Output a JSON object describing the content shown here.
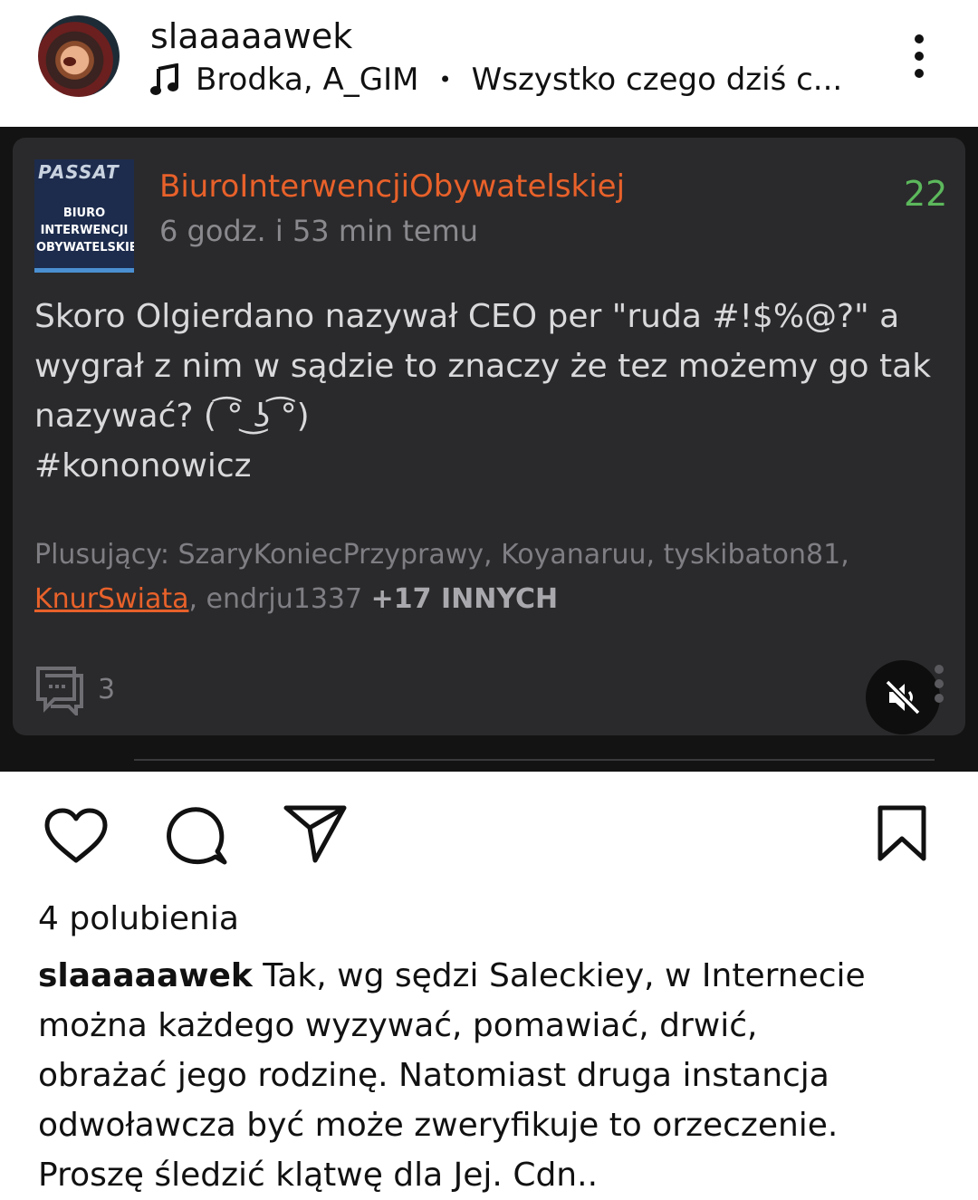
{
  "header": {
    "username": "slaaaaawek",
    "music_artist": "Brodka, A_GIM",
    "separator": "•",
    "music_title": "Wszystko czego dziś c..."
  },
  "post_card": {
    "logo_top": "PASSAT",
    "logo_lines": [
      "BIURO",
      "INTERWENCJI",
      "OBYWATELSKIE"
    ],
    "author": "BiuroInterwencjiObywatelskiej",
    "time_ago": "6 godz. i 53 min temu",
    "score": "22",
    "text_lines": [
      "Skoro Olgierdano nazywał CEO per \"ruda #!$%@?\" a",
      "wygrał z nim w sądzie to znaczy że tez możemy go tak",
      "nazywać? ( ͡° ͜ʖ ͡°)",
      "#kononowicz"
    ],
    "plus_prefix": "Plusujący: SzaryKoniecPrzyprawy, Koyanaruu, tyskibaton81,",
    "plus_user_highlight": "KnurSwiata",
    "plus_user_after": ", endrju1337 ",
    "plus_more": "+17 INNYCH",
    "comment_count": "3"
  },
  "icons": {
    "header_more": "more-vertical-icon",
    "music": "music-note-icon",
    "comment": "comment-icon",
    "mute": "volume-muted-icon",
    "like": "heart-icon",
    "reply": "comment-bubble-icon",
    "share": "send-icon",
    "save": "bookmark-icon"
  },
  "colors": {
    "accent_orange": "#e8612a",
    "score_green": "#5cb85c",
    "card_bg": "#2a2a2c"
  },
  "likes_text": "4 polubienia",
  "caption": {
    "username": "slaaaaawek",
    "first_line_rest": " Tak, wg sędzi Saleckiey, w Internecie",
    "lines": [
      "można każdego wyzywać, pomawiać, drwić,",
      "obrażać jego rodzinę. Natomiast druga instancja",
      "odwoławcza być może zweryfikuje to orzeczenie.",
      "Proszę śledzić klątwę dla Jej. Cdn.."
    ]
  }
}
